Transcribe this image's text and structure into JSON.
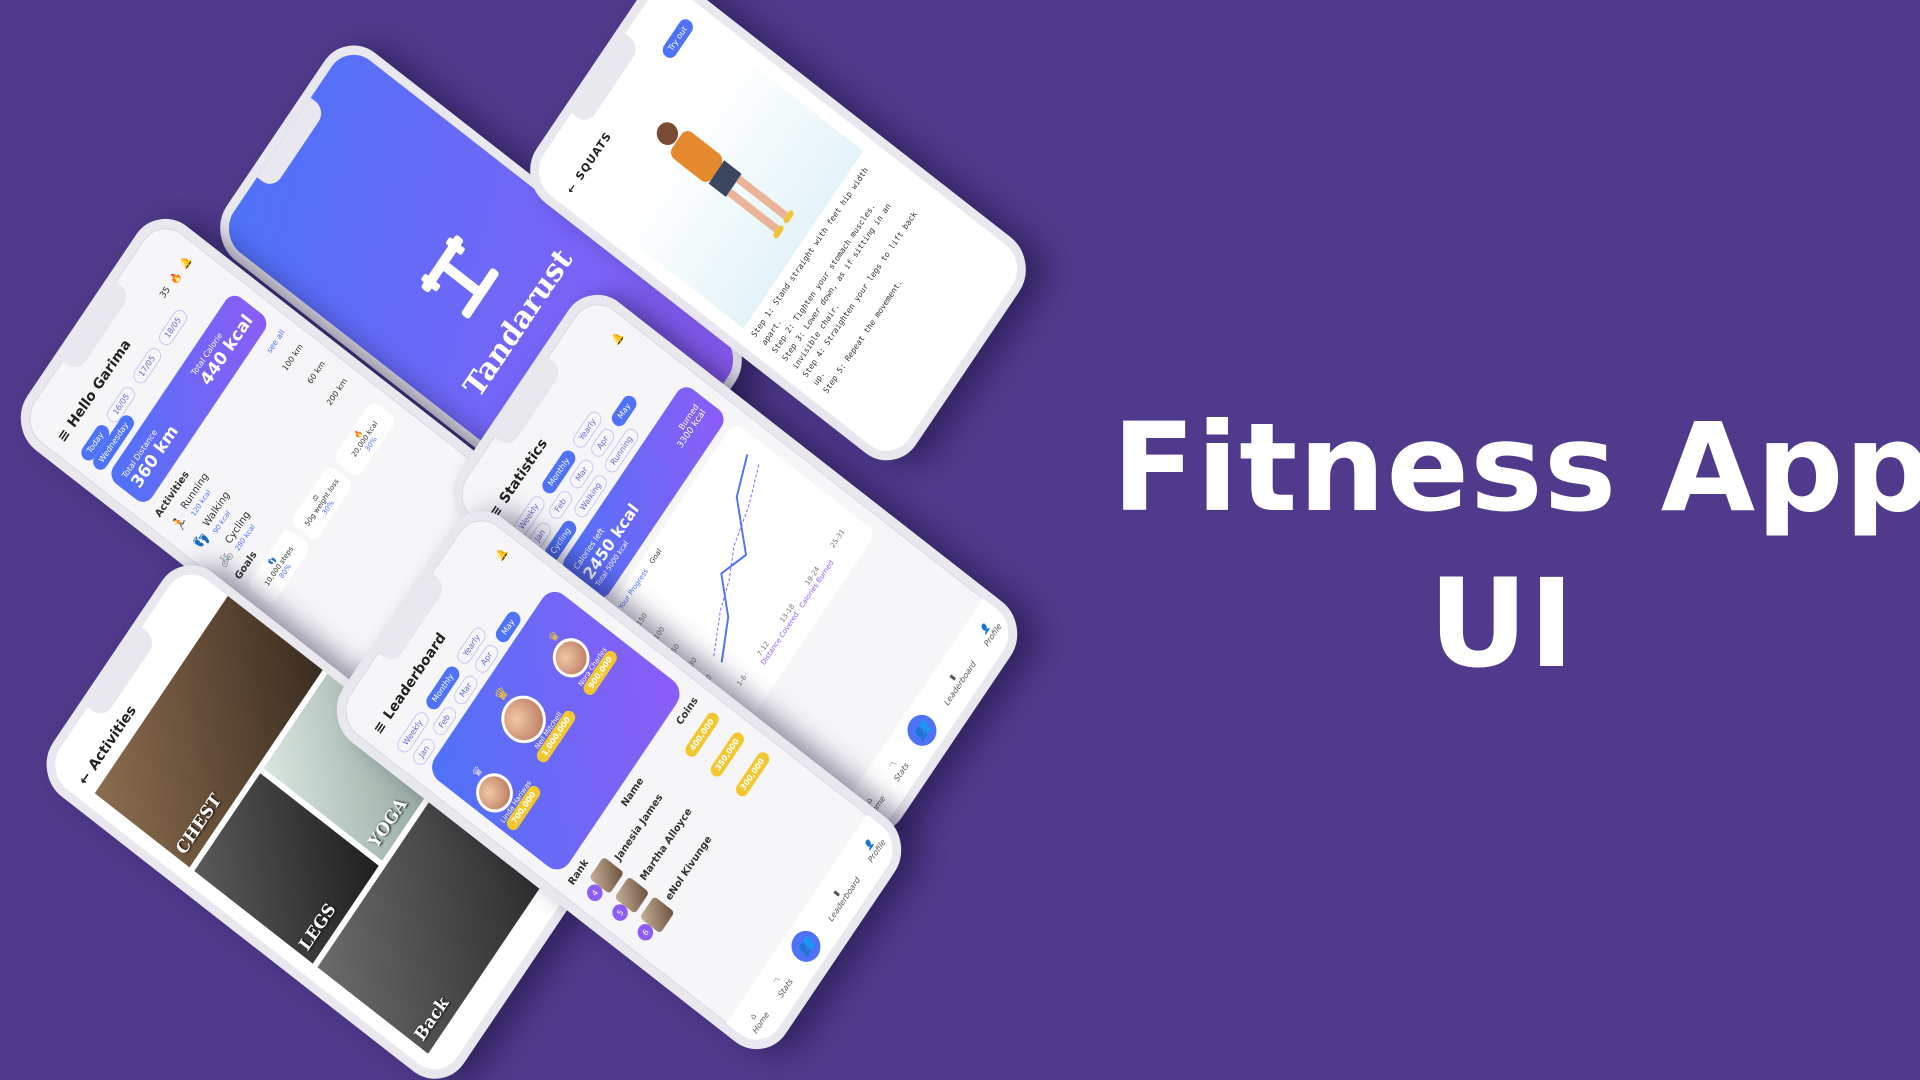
{
  "headline": {
    "line1": "Fitness App",
    "line2": "UI"
  },
  "colors": {
    "background": "#4f3a8b",
    "accent": "#4e73f8",
    "accent2": "#8e5cf6",
    "coin": "#f3c730"
  },
  "splash": {
    "brand": "Tandarust",
    "logo_icon": "dumbbell-logo-icon"
  },
  "squats": {
    "title": "SQUATS",
    "try_button": "Try out",
    "steps": [
      "Step 1: Stand straight with feet hip width apart.",
      "Step 2: Tighten your stomach muscles.",
      "Step 3: Lower down, as if sitting in an invisible chair.",
      "Step 4: Straighten your legs to lift back up.",
      "Step 5: Repeat the movement."
    ]
  },
  "home": {
    "greeting": "Hello Garima",
    "streak": "35",
    "dates": [
      "Today",
      "16/05",
      "17/05",
      "18/05",
      "19/05"
    ],
    "week_label": "Wednesday",
    "distance_label": "Total Distance",
    "distance_value": "360 km",
    "calorie_label": "Total Calorie",
    "calorie_value": "440 kcal",
    "activities_title": "Activities",
    "see_all": "see all",
    "activities": [
      {
        "name": "Running",
        "sub": "120 kcal",
        "amount": "100 km"
      },
      {
        "name": "Walking",
        "sub": "90 kcal",
        "amount": "60 km"
      },
      {
        "name": "Cycling",
        "sub": "280 kcal",
        "amount": "200 km"
      }
    ],
    "goals_title": "Goals",
    "goals": [
      {
        "label": "10,000 steps",
        "pct": "80%"
      },
      {
        "label": "50g weight loss",
        "pct": "30%"
      },
      {
        "label": "20,000 kcal",
        "pct": "30%"
      }
    ]
  },
  "nav": {
    "home": "Home",
    "stats": "Stats",
    "leaderboard": "Leaderboard",
    "profile": "Profile"
  },
  "statistics": {
    "title": "Statistics",
    "periods": [
      "Weekly",
      "Monthly",
      "Yearly"
    ],
    "months": [
      "Jan",
      "Feb",
      "Mar",
      "Apr",
      "May"
    ],
    "activity_tabs": [
      "Cycling",
      "Walking",
      "Running"
    ],
    "calories_left_label": "Calories left",
    "calories_left_value": "2450 kcal",
    "burned_label": "Burned",
    "burned_value": "3300 kcal",
    "total_label": "Total",
    "total_value": "5000 kcal",
    "legend": [
      "Your Progress",
      "Goal"
    ],
    "y_ticks": [
      "150",
      "100",
      "50",
      "30",
      "0"
    ],
    "x_ticks": [
      "1-6",
      "7-12",
      "13-18",
      "19-24",
      "25-31"
    ],
    "y_axis": "Calories Burned",
    "x_axis": "Distance Covered"
  },
  "leaderboard": {
    "title": "Leaderboard",
    "periods": [
      "Weekly",
      "Monthly",
      "Yearly"
    ],
    "months": [
      "Jan",
      "Feb",
      "Mar",
      "Apr",
      "May"
    ],
    "top": [
      {
        "name": "Neil Mitchell",
        "coins": "1,000,000"
      },
      {
        "name": "Nora Charles",
        "coins": "900,000"
      },
      {
        "name": "Linda Hariwas",
        "coins": "700,000"
      }
    ],
    "headers": [
      "Rank",
      "Name",
      "Coins"
    ],
    "rows": [
      {
        "rank": "4",
        "name": "Janesia James",
        "coins": "400,000"
      },
      {
        "rank": "5",
        "name": "Martha Alloyce",
        "coins": "350,000"
      },
      {
        "rank": "6",
        "name": "eNol Kivunge",
        "coins": "300,000"
      }
    ]
  },
  "activities": {
    "title": "Activities",
    "tiles": [
      "CHEST",
      "LEGS",
      "YOGA",
      "Back"
    ]
  }
}
